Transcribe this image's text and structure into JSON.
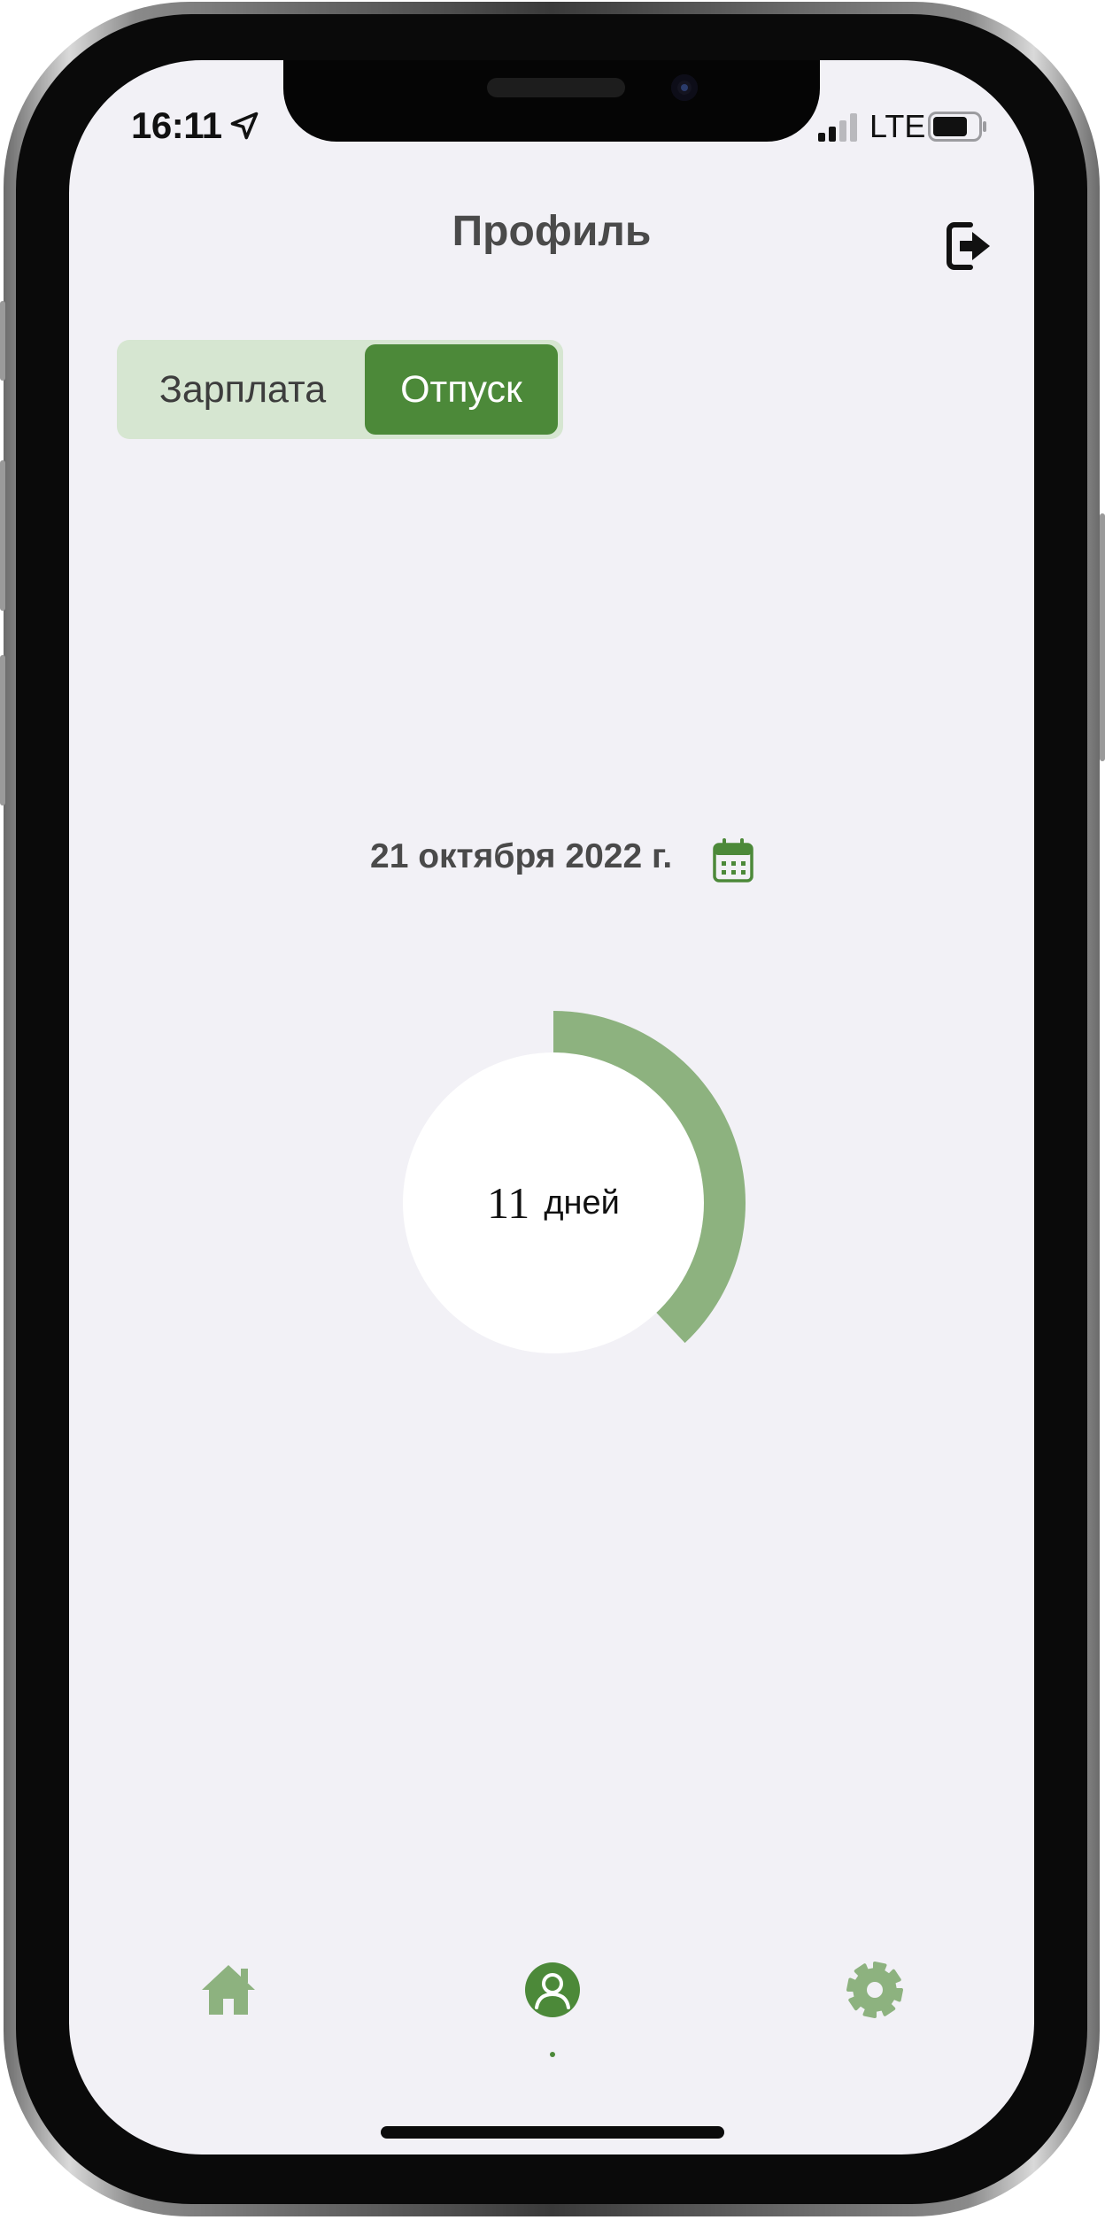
{
  "status_bar": {
    "time": "16:11",
    "network": "LTE"
  },
  "header": {
    "title": "Профиль",
    "logout_icon": "logout-icon"
  },
  "segmented_control": {
    "items": [
      {
        "label": "Зарплата",
        "selected": false
      },
      {
        "label": "Отпуск",
        "selected": true
      }
    ]
  },
  "date_selector": {
    "date": "21 октября 2022 г.",
    "icon": "calendar-icon"
  },
  "vacation_chart": {
    "value": "11",
    "unit": "дней"
  },
  "chart_data": {
    "type": "pie",
    "values": [
      0.38,
      0.62
    ],
    "colors": [
      "#8db27f",
      "#ffffff"
    ]
  },
  "tab_bar": {
    "items": [
      {
        "icon": "home-icon",
        "active": false
      },
      {
        "icon": "profile-icon",
        "active": true
      },
      {
        "icon": "gear-icon",
        "active": false
      }
    ]
  },
  "colors": {
    "accent": "#4c8939",
    "accent_light": "#8db27f",
    "segment_background": "#d6e6d1",
    "screen_background": "#f2f1f6"
  }
}
